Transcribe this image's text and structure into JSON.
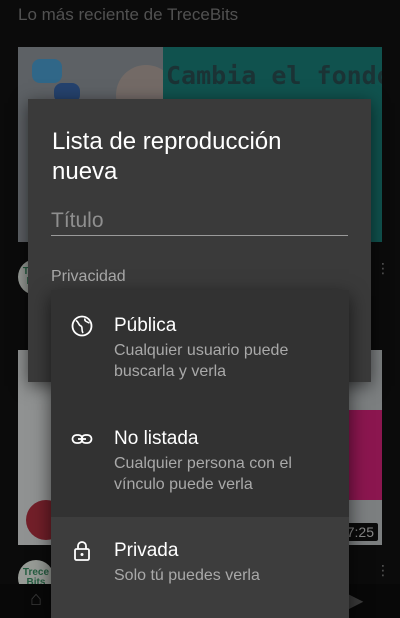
{
  "background": {
    "section_title": "Lo más reciente de TreceBits",
    "video1": {
      "thumb_text": "Cambia el fondo"
    },
    "video2": {
      "duration": "7:25"
    },
    "channel_avatar_text": "Trece\nBits"
  },
  "dialog": {
    "title": "Lista de reproducción nueva",
    "title_placeholder": "Título",
    "privacy_label": "Privacidad"
  },
  "privacy_menu": {
    "items": [
      {
        "icon": "globe-icon",
        "title": "Pública",
        "description": "Cualquier usuario puede buscarla y verla"
      },
      {
        "icon": "link-icon",
        "title": "No listada",
        "description": "Cualquier persona con el vínculo puede verla"
      },
      {
        "icon": "lock-icon",
        "title": "Privada",
        "description": "Solo tú puedes verla"
      }
    ],
    "selected": "Privada"
  }
}
